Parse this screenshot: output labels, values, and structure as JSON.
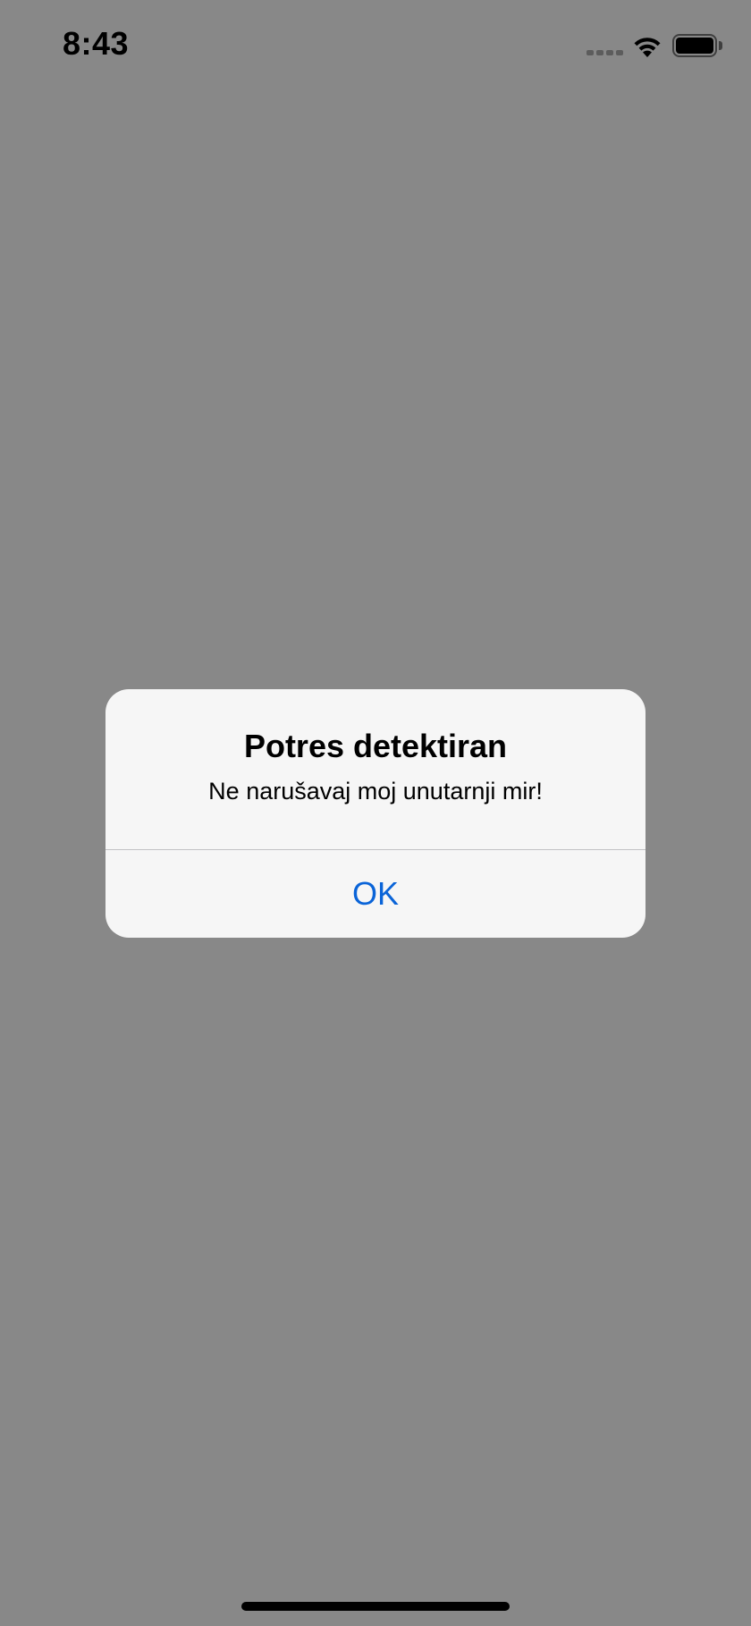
{
  "status_bar": {
    "time": "8:43",
    "icons": [
      "signal-dots-icon",
      "wifi-icon",
      "battery-icon"
    ]
  },
  "alert": {
    "title": "Potres detektiran",
    "message": "Ne narušavaj moj unutarnji mir!",
    "button_label": "OK"
  },
  "colors": {
    "background_dim": "#888888",
    "alert_background": "#f6f6f6",
    "button_text": "#0a64d8"
  }
}
